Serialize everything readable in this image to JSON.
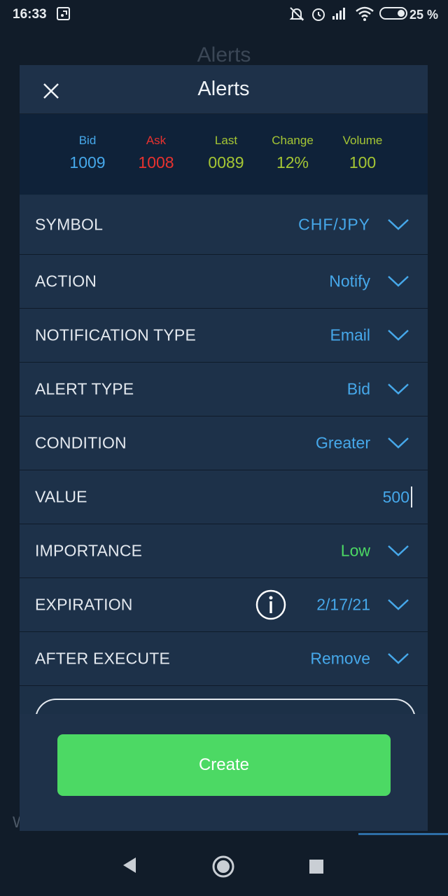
{
  "status_bar": {
    "time": "16:33",
    "battery": "25 %"
  },
  "background": {
    "title": "Alerts",
    "bottom_text": "W"
  },
  "modal": {
    "title": "Alerts",
    "quotes": [
      {
        "label": "Bid",
        "value": "1009",
        "color": "#46a8ea"
      },
      {
        "label": "Ask",
        "value": "1008",
        "color": "#e8322f"
      },
      {
        "label": "Last",
        "value": "0089",
        "color": "#a5c634"
      },
      {
        "label": "Change",
        "value": "12%",
        "color": "#a5c634"
      },
      {
        "label": "Volume",
        "value": "100",
        "color": "#a5c634"
      }
    ],
    "fields": {
      "symbol": {
        "label": "SYMBOL",
        "value": "CHF/JPY"
      },
      "action": {
        "label": "ACTION",
        "value": "Notify"
      },
      "notification_type": {
        "label": "NOTIFICATION TYPE",
        "value": "Email"
      },
      "alert_type": {
        "label": "ALERT TYPE",
        "value": "Bid"
      },
      "condition": {
        "label": "CONDITION",
        "value": "Greater"
      },
      "value": {
        "label": "VALUE",
        "value": "500"
      },
      "importance": {
        "label": "IMPORTANCE",
        "value": "Low"
      },
      "expiration": {
        "label": "EXPIRATION",
        "value": "2/17/21"
      },
      "after_execute": {
        "label": "AFTER EXECUTE",
        "value": "Remove"
      }
    },
    "create_label": "Create"
  },
  "colors": {
    "accent": "#46a8ea",
    "success": "#4cd964",
    "modal_bg": "#1c3047"
  }
}
